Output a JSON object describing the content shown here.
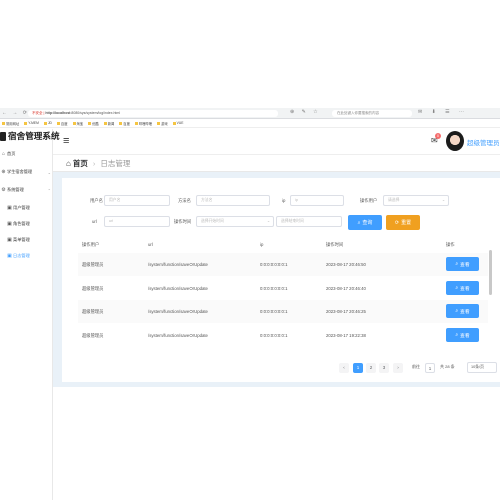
{
  "browser": {
    "url_prefix": "不安全 | ",
    "url_host": "http://localhost",
    "url_path": ":8080/sys/system/log/index.html",
    "search_placeholder": "在此处键入你要搜索的内容"
  },
  "bookmarks": [
    "常用网址",
    "Y-MEM",
    "JD",
    "百度",
    "淘宝",
    "优酷",
    "新闻",
    "百度",
    "哔哩哔哩",
    "游戏",
    "VUE"
  ],
  "sidebar": {
    "logo_text": "宿舍管理系统",
    "items": [
      {
        "label": "首页",
        "icon": "home-icon"
      },
      {
        "label": "学生宿舍管理",
        "icon": "building-icon",
        "arrow": "⌄"
      },
      {
        "label": "系统管理",
        "icon": "gear-icon",
        "arrow": "⌃"
      },
      {
        "label": "用户管理",
        "icon": "user-icon"
      },
      {
        "label": "角色管理",
        "icon": "role-icon"
      },
      {
        "label": "菜单管理",
        "icon": "menu-icon"
      },
      {
        "label": "日志管理",
        "icon": "log-icon"
      }
    ]
  },
  "header": {
    "mail_badge": "0",
    "username": "超级管理员"
  },
  "breadcrumb": {
    "home": "首页",
    "current": "日志管理"
  },
  "filters": {
    "username_label": "用户名",
    "username_placeholder": "用户名",
    "method_label": "方法名",
    "method_placeholder": "方法名",
    "ip_label": "ip",
    "ip_placeholder": "ip",
    "type_label": "操作用户",
    "type_placeholder": "请选择",
    "url_label": "url",
    "url_placeholder": "url",
    "time_label": "操作时间",
    "time_start_placeholder": "选择开始时间",
    "time_end_placeholder": "选择结束时间",
    "query_label": "查询",
    "reset_label": "重置"
  },
  "table": {
    "headers": [
      "操作用户",
      "url",
      "ip",
      "操作时间",
      "操作"
    ],
    "rows": [
      {
        "user": "超级管理员",
        "url": "/system/function/saveOrUpdate",
        "ip": "0:0:0:0:0:0:0:1",
        "time": "2023-08-17 20:46:50"
      },
      {
        "user": "超级管理员",
        "url": "/system/function/saveOrUpdate",
        "ip": "0:0:0:0:0:0:0:1",
        "time": "2023-08-17 20:46:40"
      },
      {
        "user": "超级管理员",
        "url": "/system/function/saveOrUpdate",
        "ip": "0:0:0:0:0:0:0:1",
        "time": "2023-08-17 20:46:25"
      },
      {
        "user": "超级管理员",
        "url": "/system/function/saveOrUpdate",
        "ip": "0:0:0:0:0:0:0:1",
        "time": "2023-08-17 19:22:38"
      }
    ],
    "view_label": "查看"
  },
  "pagination": {
    "prev": "‹",
    "pages": [
      "1",
      "2",
      "3"
    ],
    "next": "›",
    "goto_label": "前往",
    "goto_value": "1",
    "total": "共 28 条",
    "page_size": "10条/页"
  },
  "colors": {
    "primary": "#409eff",
    "warning": "#f0a020",
    "danger": "#f56c6c"
  }
}
